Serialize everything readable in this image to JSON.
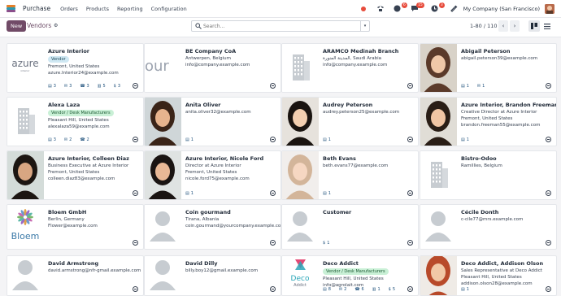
{
  "navbar": {
    "app_name": "Purchase",
    "menu": [
      "Orders",
      "Products",
      "Reporting",
      "Configuration"
    ],
    "badges": {
      "activity": "6",
      "messages": "15",
      "chat": "3"
    },
    "company": "My Company (San Francisco)"
  },
  "control_panel": {
    "new_label": "New",
    "breadcrumb": "Vendors",
    "search_placeholder": "Search...",
    "pager": "1-80 / 110"
  },
  "cards": [
    {
      "title": "Azure Interior",
      "tag": "Vendor",
      "tag_color": "blue",
      "lines": [
        "Fremont, United States",
        "azure.Interior24@example.com"
      ],
      "stats": [
        "3",
        "3",
        "3",
        "5",
        "3"
      ],
      "image": "azure-logo"
    },
    {
      "title": "BE Company CoA",
      "tag": "",
      "lines": [
        "Antwerpen, Belgium",
        "info@company.example.com"
      ],
      "stats": [],
      "image": "bcompany-logo"
    },
    {
      "title": "ARAMCO Medinah Branch",
      "tag": "",
      "lines": [
        "المدينة المنورة, Saudi Arabia",
        "info@company.example.com"
      ],
      "stats": [],
      "image": "building"
    },
    {
      "title": "Abigail Peterson",
      "tag": "",
      "lines": [
        "abigail.peterson39@example.com"
      ],
      "stats": [
        "1",
        "1"
      ],
      "image": "photo-abigail"
    },
    {
      "title": "Alexa Laza",
      "tag": "Vendor / Desk Manufacturers",
      "tag_color": "green",
      "lines": [
        "Pleasant Hill, United States",
        "alexalaza59@example.com"
      ],
      "stats": [
        "3",
        "2",
        "2"
      ],
      "image": "building"
    },
    {
      "title": "Anita Oliver",
      "tag": "",
      "lines": [
        "anita.oliver32@example.com"
      ],
      "stats": [
        "1"
      ],
      "image": "photo-anita"
    },
    {
      "title": "Audrey Peterson",
      "tag": "",
      "lines": [
        "audrey.peterson25@example.com"
      ],
      "stats": [
        "1"
      ],
      "image": "photo-audrey"
    },
    {
      "title": "Azure Interior, Brandon Freeman",
      "tag": "",
      "lines": [
        "Creative Director at Azure Interior",
        "Fremont, United States",
        "brandon.freeman55@example.com"
      ],
      "stats": [
        "1"
      ],
      "image": "photo-brandon"
    },
    {
      "title": "Azure Interior, Colleen Diaz",
      "tag": "",
      "lines": [
        "Business Executive at Azure Interior",
        "Fremont, United States",
        "colleen.diaz83@example.com"
      ],
      "stats": [],
      "image": "photo-colleen"
    },
    {
      "title": "Azure Interior, Nicole Ford",
      "tag": "",
      "lines": [
        "Director at Azure Interior",
        "Fremont, United States",
        "nicole.ford75@example.com"
      ],
      "stats": [
        "1"
      ],
      "image": "photo-nicole"
    },
    {
      "title": "Beth Evans",
      "tag": "",
      "lines": [
        "beth.evans77@example.com"
      ],
      "stats": [
        "1"
      ],
      "image": "photo-beth"
    },
    {
      "title": "Bistro-Odoo",
      "tag": "",
      "lines": [
        "Ramillies, Belgium"
      ],
      "stats": [],
      "image": "building"
    },
    {
      "title": "Bloem GmbH",
      "tag": "",
      "lines": [
        "Berlin, Germany",
        "Flower@example.com"
      ],
      "stats": [],
      "image": "bloem-logo"
    },
    {
      "title": "Coin gourmand",
      "tag": "",
      "lines": [
        "Tirana, Albania",
        "coin.gourmand@yourcompany.example.com"
      ],
      "stats": [],
      "image": "person"
    },
    {
      "title": "Customer",
      "tag": "",
      "lines": [],
      "stats": [
        "1"
      ],
      "stat_icon": "$",
      "image": "person"
    },
    {
      "title": "Cécile Donth",
      "tag": "",
      "lines": [
        "c-cile77@mrs.example.com"
      ],
      "stats": [],
      "image": "person"
    },
    {
      "title": "David Armstrong",
      "tag": "",
      "lines": [
        "david.armstrong@nfr-gmail.example.com"
      ],
      "stats": [],
      "image": "person"
    },
    {
      "title": "David Dilly",
      "tag": "",
      "lines": [
        "billy.boy12@gmail.example.com"
      ],
      "stats": [],
      "image": "person"
    },
    {
      "title": "Deco Addict",
      "tag": "Vendor / Desk Manufacturers",
      "tag_color": "green",
      "lines": [
        "Pleasant Hill, United States",
        "info@agrolait.com"
      ],
      "stats": [
        "8",
        "2",
        "6",
        "1",
        "5"
      ],
      "image": "deco-logo"
    },
    {
      "title": "Deco Addict, Addison Olson",
      "tag": "",
      "lines": [
        "Sales Representative at Deco Addict",
        "Pleasant Hill, United States",
        "addison.olson28@example.com"
      ],
      "stats": [
        "1"
      ],
      "image": "photo-addison"
    }
  ],
  "colors": {
    "accent": "#714b67",
    "brand_teal": "#3ba5b5",
    "tag_green": "#c9f0d6",
    "tag_blue": "#cfe8f3"
  }
}
